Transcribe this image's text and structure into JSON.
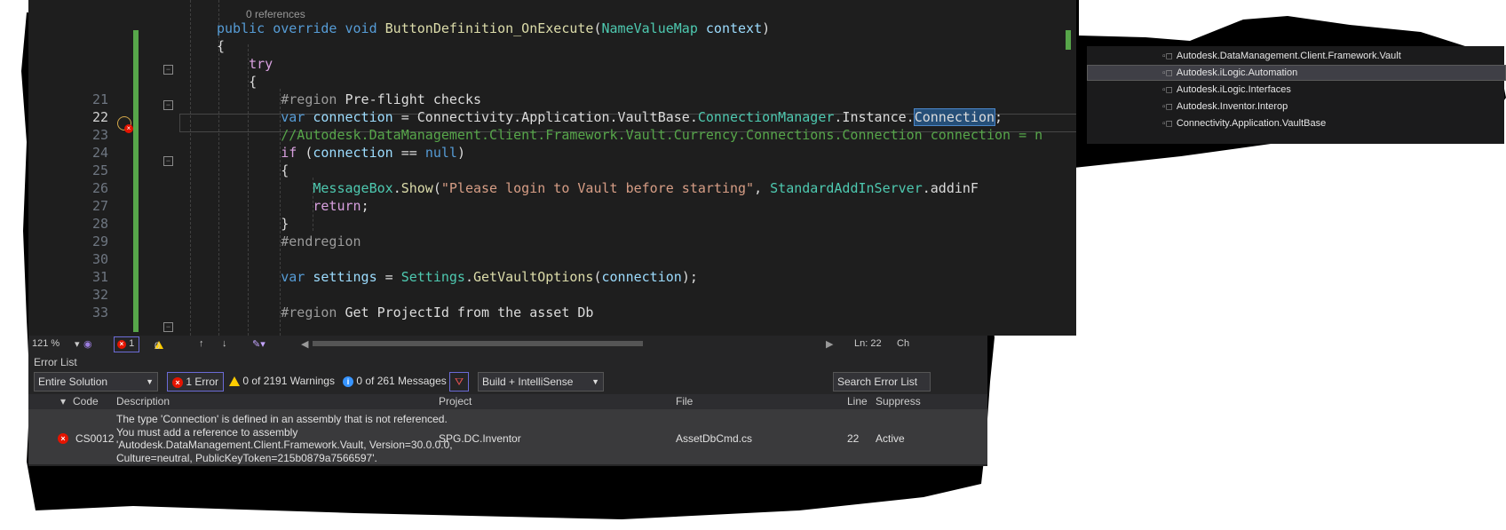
{
  "editor": {
    "references": "0 references",
    "lines": [
      {
        "num": "",
        "html": "<span class='kw'>public</span> <span class='kw'>override</span> <span class='kw'>void</span> <span class='fn'>ButtonDefinition_OnExecute</span>(<span class='ty'>NameValueMap</span> <span class='pa'>context</span>)"
      },
      {
        "num": "",
        "html": "{"
      },
      {
        "num": "",
        "html": "    <span class='kw2'>try</span>"
      },
      {
        "num": "",
        "html": "    {"
      },
      {
        "num": "21",
        "html": "        <span class='rg'>#region</span> Pre-flight checks"
      },
      {
        "num": "22",
        "html": "        <span class='kw'>var</span> <span class='pa'>connection</span> = Connectivity.Application.VaultBase.<span class='ty'>ConnectionManager</span>.Instance.<span class='hl'>Connection</span>;"
      },
      {
        "num": "23",
        "html": "        <span class='cm'>//Autodesk.DataManagement.Client.Framework.Vault.Currency.Connections.Connection connection = n</span>"
      },
      {
        "num": "24",
        "html": "        <span class='kw2'>if</span> (<span class='pa'>connection</span> == <span class='kw'>null</span>)"
      },
      {
        "num": "25",
        "html": "        {"
      },
      {
        "num": "26",
        "html": "            <span class='ty'>MessageBox</span>.<span class='fn'>Show</span>(<span class='st'>\"Please login to Vault before starting\"</span>, <span class='ty'>StandardAddInServer</span>.addinF"
      },
      {
        "num": "27",
        "html": "            <span class='kw2'>return</span>;"
      },
      {
        "num": "28",
        "html": "        }"
      },
      {
        "num": "29",
        "html": "        <span class='rg'>#endregion</span>"
      },
      {
        "num": "30",
        "html": ""
      },
      {
        "num": "31",
        "html": "        <span class='kw'>var</span> <span class='pa'>settings</span> = <span class='ty'>Settings</span>.<span class='fn'>GetVaultOptions</span>(<span class='pa'>connection</span>);"
      },
      {
        "num": "32",
        "html": ""
      },
      {
        "num": "33",
        "html": "        <span class='rg'>#region</span> Get ProjectId from the asset Db"
      }
    ]
  },
  "status": {
    "zoom": "121 %",
    "errors": "1",
    "warnings": "0",
    "position": "Ln: 22",
    "char": "Ch"
  },
  "error_list": {
    "title": "Error List",
    "scope": "Entire Solution",
    "errors_label": "1 Error",
    "warnings_label": "0 of 2191 Warnings",
    "messages_label": "0 of 261 Messages",
    "build_filter": "Build + IntelliSense",
    "search_placeholder": "Search Error List",
    "columns": {
      "code": "Code",
      "description": "Description",
      "project": "Project",
      "file": "File",
      "line": "Line",
      "suppression": "Suppress"
    },
    "rows": [
      {
        "code": "CS0012",
        "description_lines": [
          "The type 'Connection' is defined in an assembly that is not referenced.",
          "You must add a reference to assembly",
          "'Autodesk.DataManagement.Client.Framework.Vault, Version=30.0.0.0,",
          "Culture=neutral, PublicKeyToken=215b0879a7566597'."
        ],
        "project": "SPG.DC.Inventor",
        "file": "AssetDbCmd.cs",
        "line": "22",
        "suppression": "Active"
      }
    ]
  },
  "solution_explorer": {
    "references": [
      "Autodesk.DataManagement.Client.Framework.Vault",
      "Autodesk.iLogic.Automation",
      "Autodesk.iLogic.Interfaces",
      "Autodesk.Inventor.Interop",
      "Connectivity.Application.VaultBase"
    ],
    "selected_index": 1
  }
}
